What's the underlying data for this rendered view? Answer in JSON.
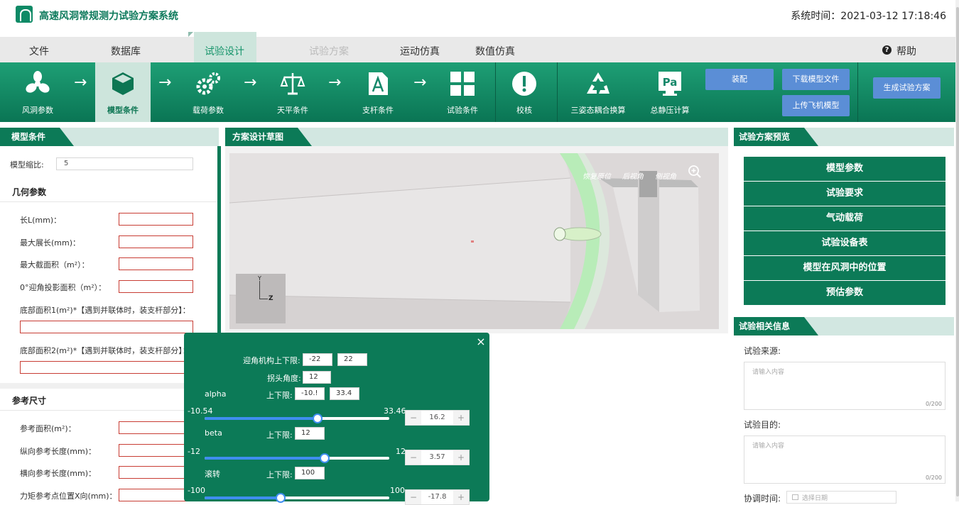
{
  "header": {
    "app_title": "高速风洞常规测力试验方案系统",
    "system_time": "系统时间：2021-03-12 17:18:46"
  },
  "menu": {
    "items": [
      "文件",
      "数据库",
      "试验设计",
      "试验方案",
      "运动仿真",
      "数值仿真"
    ],
    "active": "试验设计",
    "disabled": "试验方案",
    "help": "帮助"
  },
  "toolbar": {
    "items": [
      {
        "label": "风洞参数",
        "icon": "fan-icon"
      },
      {
        "label": "模型条件",
        "icon": "cube-icon"
      },
      {
        "label": "载荷参数",
        "icon": "gears-icon"
      },
      {
        "label": "天平条件",
        "icon": "balance-icon"
      },
      {
        "label": "支杆条件",
        "icon": "document-a-icon"
      },
      {
        "label": "试验条件",
        "icon": "grid-icon"
      },
      {
        "label": "校核",
        "icon": "alert-icon"
      },
      {
        "label": "三姿态耦合换算",
        "icon": "recycle-triangle-icon"
      },
      {
        "label": "总静压计算",
        "icon": "pa-icon"
      }
    ],
    "buttons": {
      "assemble": "装配",
      "download_model": "下载模型文件",
      "upload_aircraft": "上传飞机模型",
      "generate_plan": "生成试验方案"
    }
  },
  "left_panel": {
    "title": "模型条件",
    "scale_label": "模型缩比:",
    "scale_value": "5",
    "geometry_title": "几何参数",
    "geometry_fields": [
      "长L(mm)：",
      "最大展长(mm)：",
      "最大截面积（m²）：",
      "0°迎角投影面积（m²）："
    ],
    "base_area1": "底部面积1(m²)*【遇到并联体时，装支杆部分】：",
    "base_area2": "底部面积2(m²)*【遇到并联体时，装支杆部分】：",
    "ref_title": "参考尺寸",
    "ref_fields": [
      "参考面积(m²)：",
      "纵向参考长度(mm)：",
      "横向参考长度(mm)：",
      "力矩参考点位置X向(mm)："
    ]
  },
  "center_panel": {
    "title": "方案设计草图",
    "view_actions": [
      "恢复原位",
      "后视角",
      "侧视角"
    ],
    "axis_y": "Y",
    "axis_z": "Z"
  },
  "popup": {
    "aoa_limit_label": "迎角机构上下限:",
    "aoa_min": "-22",
    "aoa_max": "22",
    "head_angle_label": "拐头角度:",
    "head_angle": "12",
    "alpha": {
      "name": "alpha",
      "limit_label": "上下限:",
      "min_input": "-10.!",
      "max_input": "33.4",
      "min": "-10.54",
      "max": "33.46",
      "value": "16.2",
      "fraction": 0.61
    },
    "beta": {
      "name": "beta",
      "limit_label": "上下限:",
      "limit_input": "12",
      "min": "-12",
      "max": "12",
      "value": "3.57",
      "fraction": 0.65
    },
    "roll": {
      "name": "滚转",
      "limit_label": "上下限:",
      "limit_input": "100",
      "min": "-100",
      "max": "100",
      "value": "-17.8",
      "fraction": 0.41
    },
    "minus": "−",
    "plus": "+",
    "close": "×"
  },
  "right_panel": {
    "preview_title": "试验方案预览",
    "preview_items": [
      "模型参数",
      "试验要求",
      "气动载荷",
      "试验设备表",
      "模型在风洞中的位置",
      "预估参数"
    ],
    "info_title": "试验相关信息",
    "source_label": "试验来源:",
    "source_placeholder": "请输入内容",
    "source_count": "0/200",
    "purpose_label": "试验目的:",
    "purpose_placeholder": "请输入内容",
    "purpose_count": "0/200",
    "coord_label": "协调时间:",
    "date_placeholder": "选择日期"
  }
}
